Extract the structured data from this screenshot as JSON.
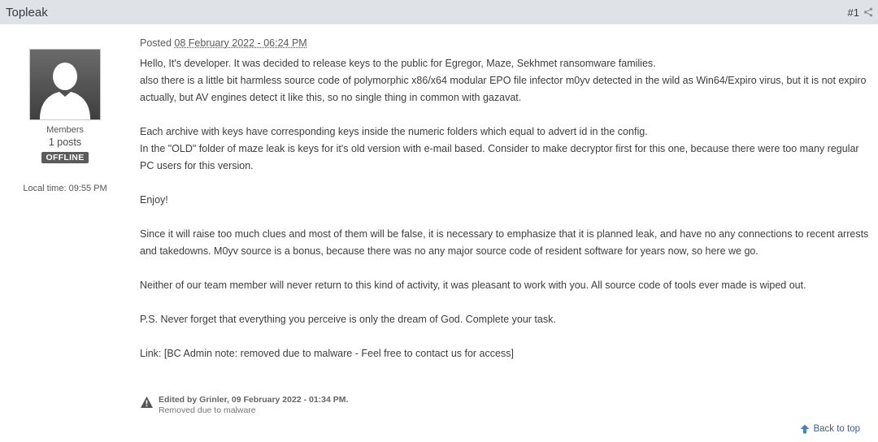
{
  "header": {
    "author": "Topleak",
    "post_number": "#1",
    "share_icon": "share-icon"
  },
  "profile": {
    "avatar_icon": "user-silhouette-icon",
    "group": "Members",
    "posts": "1 posts",
    "status": "OFFLINE",
    "local_time": "Local time: 09:55 PM"
  },
  "post": {
    "posted_label": "Posted",
    "date": "08 February 2022 - 06:24 PM",
    "paragraphs": {
      "p1_line1": "Hello, It's developer. It was decided to release keys to the public for Egregor, Maze, Sekhmet ransomware families.",
      "p1_line2": "also there is a little bit harmless source code of polymorphic x86/x64 modular EPO file infector m0yv detected in the wild as Win64/Expiro virus, but it is not expiro actually, but AV engines detect it like this, so no single thing in common with gazavat.",
      "p2_line1": "Each archive with keys have corresponding keys inside the numeric folders which equal to advert id in the config.",
      "p2_line2": "In the \"OLD\" folder of maze leak is keys for it's old version with e-mail based. Consider to make decryptor first for this one, because there were too many regular PC users for this version.",
      "p3": "Enjoy!",
      "p4": "Since it will raise too much clues and most of them will be false, it is necessary to emphasize that it is planned leak, and have no any connections to recent arrests and takedowns. M0yv source is a bonus, because there was no any major source code of resident software for years now, so here we go.",
      "p5": "Neither of our team member will never return to this kind of activity, it was pleasant to work with you. All source code of tools ever made is wiped out.",
      "p6": "P.S. Never forget that everything you perceive is only the dream of God. Complete your task.",
      "p7": "Link: [BC Admin note: removed due to malware - Feel free to contact us for access]"
    },
    "edited": {
      "icon": "warning-icon",
      "line1": "Edited by Grinler, 09 February 2022 - 01:34 PM.",
      "line2": "Removed due to malware"
    }
  },
  "footer": {
    "back_to_top": "Back to top",
    "icon": "arrow-up-icon"
  },
  "colors": {
    "header_bg": "#dfe2e7",
    "status_bg": "#5b5b5b",
    "link": "#3b5c8a"
  }
}
